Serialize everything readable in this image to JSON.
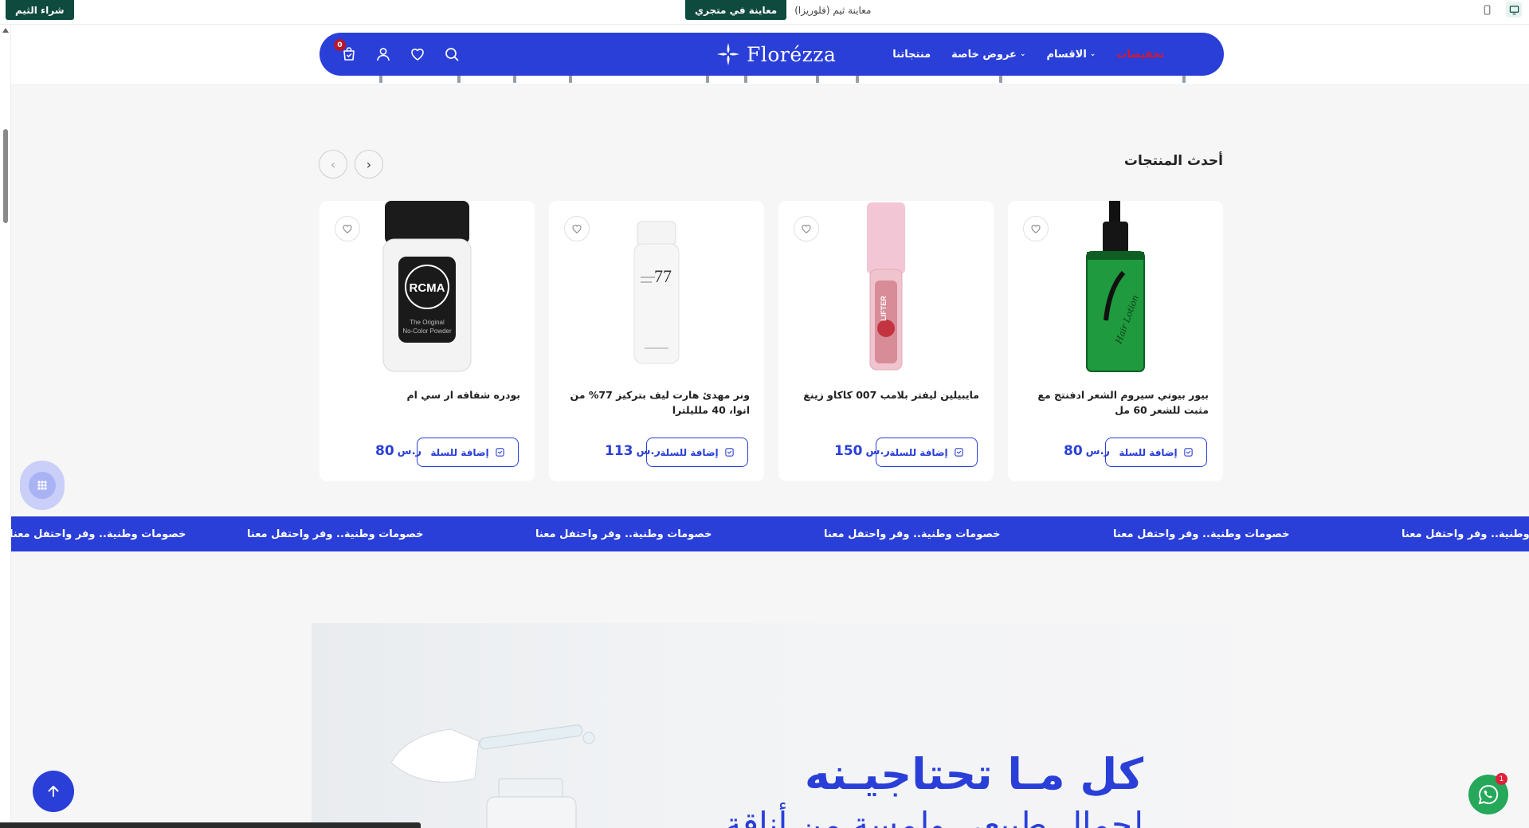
{
  "topbar": {
    "buy_theme": "شراء الثيم",
    "preview_store": "معاينة في متجري",
    "preview_label": "معاينة ثيم (فلوريزا)"
  },
  "nav": {
    "logo": "Florézza",
    "cart_count": "0",
    "links": [
      "تخفيضات",
      "الاقسام",
      "عروض خاصة",
      "منتجاتنا"
    ],
    "icons": [
      "cart-icon",
      "user-icon",
      "heart-icon",
      "search-icon"
    ]
  },
  "section": {
    "title": "أحدث المنتجات"
  },
  "products": [
    {
      "name": "بيور بيوتي سيروم الشعر ادفنتج مع مثبت للشعر 60 مل",
      "price": "80",
      "add_label": "إضافة للسلة"
    },
    {
      "name": "مايبيلين ليفتر بلامب 007 كاكاو زينغ",
      "price": "150",
      "add_label": "إضافة للسلة"
    },
    {
      "name": "ونر مهدئ هارت ليف بتركيز 77% من انوا، 40 ملليلترا",
      "price": "113",
      "add_label": "إضافة للسلة"
    },
    {
      "name": "بودره شفافه ار سي ام",
      "price": "80",
      "add_label": "إضافة للسلة"
    }
  ],
  "product_images": {
    "p4_brand": "RCMA",
    "p4_sub": "The Original No-Color Powder",
    "p3_brand": "77",
    "p2_brand": "LIFTER",
    "p1_brand": "Hair Lotion"
  },
  "currency_symbol": "ر.س",
  "marquee": {
    "items": [
      "خصومات وطنية.. وفر واحتفل معنا",
      "خصومات وطنية.. وفر واحتفل معنا",
      "خصومات وطنية.. وفر واحتفل معنا",
      "خصومات وطنية.. وفر واحتفل معنا",
      "خصومات وطنية.. وفر واحتفل معنا",
      "خصومات وطنية.. وفر واحتفل معنا"
    ]
  },
  "banner": {
    "headline": "كل مـا تحتاجيـنه",
    "subline": "لجمال طبيعي ولمسة من أناقة"
  },
  "whatsapp_badge": "1",
  "colors": {
    "brand": "#2a3fd8",
    "sale": "#d9172d",
    "topbar_button": "#0f4a3f",
    "whatsapp": "#25a85a"
  }
}
